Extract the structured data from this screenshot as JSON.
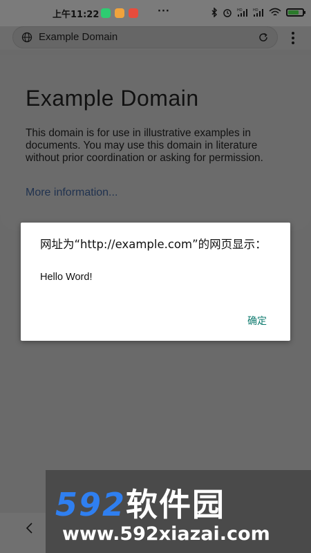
{
  "status_bar": {
    "time": "上午11:22",
    "more_indicator": "···",
    "signal_labels": [
      "HD",
      "HD"
    ],
    "app_icon_colors": [
      "#2ecc71",
      "#f1a33c",
      "#e74c3c"
    ],
    "battery_level": 0.75
  },
  "browser": {
    "address_text": "Example Domain"
  },
  "page": {
    "heading": "Example Domain",
    "paragraph": "This domain is for use in illustrative examples in documents. You may use this domain in literature without prior coordination or asking for permission.",
    "link_text": "More information..."
  },
  "dialog": {
    "title": "网址为“http://example.com”的网页显示：",
    "message": "Hello Word!",
    "ok_label": "确定"
  },
  "watermark": {
    "brand_digits": "592",
    "brand_cn": "软件园",
    "url": "www.592xiazai.com"
  },
  "colors": {
    "accent": "#0d7a6e",
    "link": "#20324f",
    "brand_blue": "#2f7ff0"
  }
}
